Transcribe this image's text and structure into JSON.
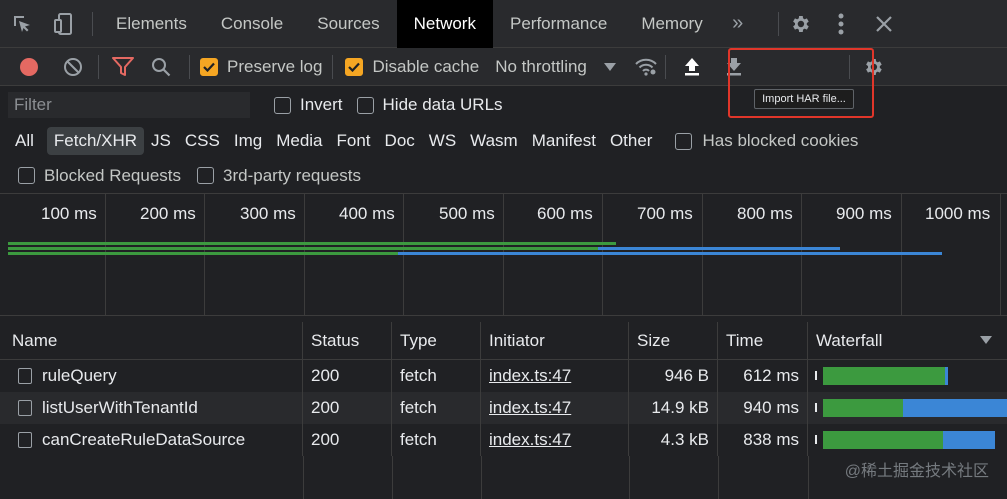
{
  "tabs": [
    "Elements",
    "Console",
    "Sources",
    "Network",
    "Performance",
    "Memory"
  ],
  "active_tab": "Network",
  "toolbar": {
    "preserve_log": "Preserve log",
    "disable_cache": "Disable cache",
    "throttling": "No throttling",
    "import_tooltip": "Import HAR file..."
  },
  "filter": {
    "placeholder": "Filter",
    "invert": "Invert",
    "hide_data_urls": "Hide data URLs"
  },
  "types": [
    "All",
    "Fetch/XHR",
    "JS",
    "CSS",
    "Img",
    "Media",
    "Font",
    "Doc",
    "WS",
    "Wasm",
    "Manifest",
    "Other"
  ],
  "selected_type": "Fetch/XHR",
  "has_blocked_cookies": "Has blocked cookies",
  "blocked_requests": "Blocked Requests",
  "third_party": "3rd-party requests",
  "overview": {
    "ticks": [
      "100 ms",
      "200 ms",
      "300 ms",
      "400 ms",
      "500 ms",
      "600 ms",
      "700 ms",
      "800 ms",
      "900 ms",
      "1000 ms"
    ]
  },
  "table": {
    "headers": [
      "Name",
      "Status",
      "Type",
      "Initiator",
      "Size",
      "Time",
      "Waterfall"
    ],
    "rows": [
      {
        "name": "ruleQuery",
        "status": "200",
        "type": "fetch",
        "initiator": "index.ts:47",
        "size": "946 B",
        "time": "612 ms"
      },
      {
        "name": "listUserWithTenantId",
        "status": "200",
        "type": "fetch",
        "initiator": "index.ts:47",
        "size": "14.9 kB",
        "time": "940 ms"
      },
      {
        "name": "canCreateRuleDataSource",
        "status": "200",
        "type": "fetch",
        "initiator": "index.ts:47",
        "size": "4.3 kB",
        "time": "838 ms"
      }
    ]
  },
  "colors": {
    "waiting": "#3c9a3f",
    "download": "#3b86d6",
    "accent": "#f5a623",
    "record": "#e46962"
  },
  "watermark": "@稀土掘金技术社区"
}
